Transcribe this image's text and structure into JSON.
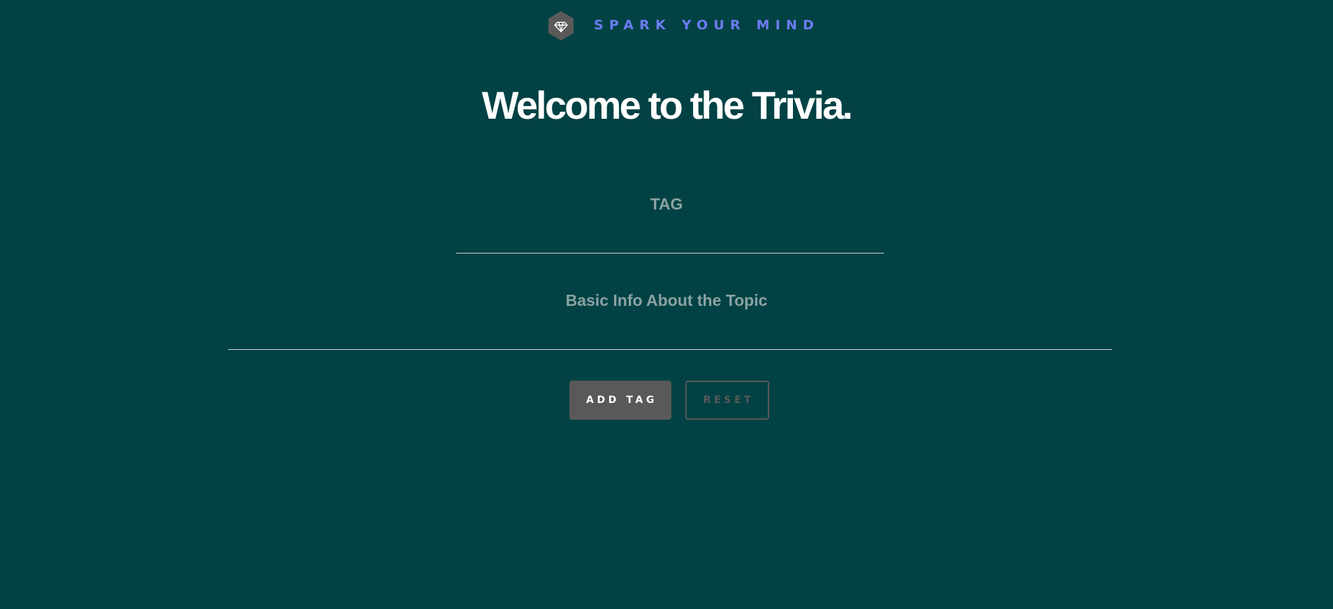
{
  "brand": {
    "logo_icon": "diamond-hexagon-icon",
    "name": "SPARK YOUR MIND",
    "color": "#6c7cf2"
  },
  "page": {
    "title": "Welcome to the Trivia.",
    "background": "#024244"
  },
  "form": {
    "tag_label": "TAG",
    "tag_value": "",
    "info_label": "Basic Info About the Topic",
    "info_value": ""
  },
  "actions": {
    "add_label": "ADD TAG",
    "reset_label": "RESET"
  }
}
